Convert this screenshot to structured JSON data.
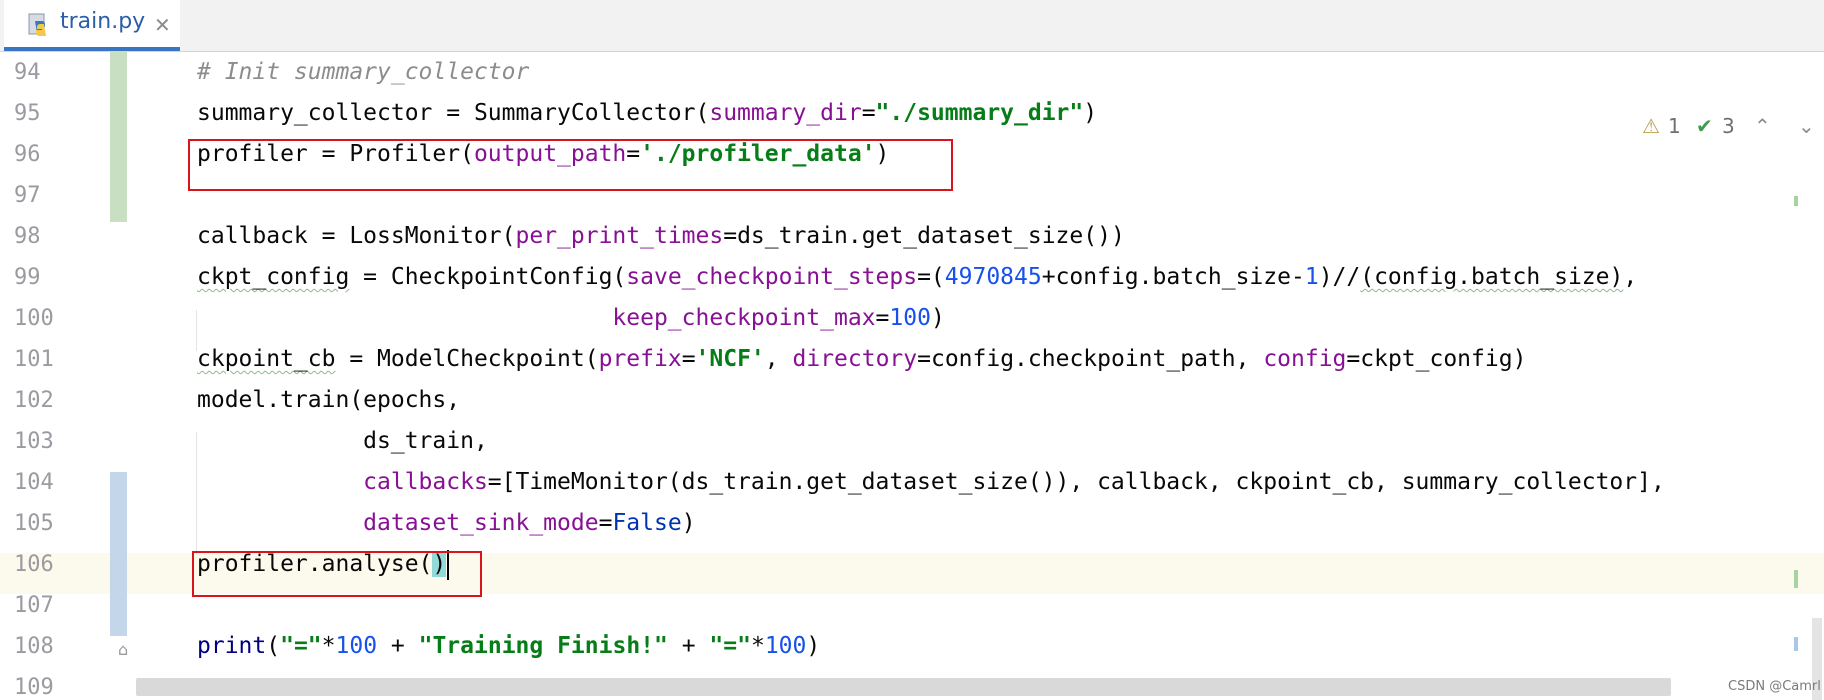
{
  "tab": {
    "filename": "train.py",
    "file_icon": "python-file-icon",
    "close_glyph": "✕"
  },
  "inspections": {
    "warning_count": "1",
    "ok_count": "3"
  },
  "editor": {
    "lines": [
      {
        "number": "94",
        "tokens": [
          {
            "t": "# Init summary_collector",
            "c": "comment"
          }
        ]
      },
      {
        "number": "95",
        "tokens": [
          {
            "t": "summary_collector = SummaryCollector("
          },
          {
            "t": "summary_dir",
            "c": "kw-arg"
          },
          {
            "t": "="
          },
          {
            "t": "\"./summary_dir\"",
            "c": "str"
          },
          {
            "t": ")"
          }
        ]
      },
      {
        "number": "96",
        "tokens": [
          {
            "t": "profiler = Profiler("
          },
          {
            "t": "output_path",
            "c": "kw-arg"
          },
          {
            "t": "="
          },
          {
            "t": "'./profiler_data'",
            "c": "str"
          },
          {
            "t": ")"
          }
        ]
      },
      {
        "number": "97",
        "tokens": []
      },
      {
        "number": "98",
        "tokens": [
          {
            "t": "callback = LossMonitor("
          },
          {
            "t": "per_print_times",
            "c": "kw-arg"
          },
          {
            "t": "=ds_train.get_dataset_size())"
          }
        ]
      },
      {
        "number": "99",
        "tokens": [
          {
            "t": "ckpt_config",
            "c": "wavy"
          },
          {
            "t": " = CheckpointConfig("
          },
          {
            "t": "save_checkpoint_steps",
            "c": "kw-arg"
          },
          {
            "t": "=("
          },
          {
            "t": "4970845",
            "c": "num"
          },
          {
            "t": "+config.batch_size-"
          },
          {
            "t": "1",
            "c": "num"
          },
          {
            "t": ")//"
          },
          {
            "t": "(config.batch_size)",
            "c": "wavy"
          },
          {
            "t": ","
          }
        ]
      },
      {
        "number": "100",
        "tokens": [
          {
            "t": "                              "
          },
          {
            "t": "keep_checkpoint_max",
            "c": "kw-arg"
          },
          {
            "t": "="
          },
          {
            "t": "100",
            "c": "num"
          },
          {
            "t": ")"
          }
        ]
      },
      {
        "number": "101",
        "tokens": [
          {
            "t": "ckpoint_cb",
            "c": "wavy"
          },
          {
            "t": " = ModelCheckpoint("
          },
          {
            "t": "prefix",
            "c": "kw-arg"
          },
          {
            "t": "="
          },
          {
            "t": "'NCF'",
            "c": "str"
          },
          {
            "t": ", "
          },
          {
            "t": "directory",
            "c": "kw-arg"
          },
          {
            "t": "=config.checkpoint_path, "
          },
          {
            "t": "config",
            "c": "kw-arg"
          },
          {
            "t": "=ckpt_config)"
          }
        ]
      },
      {
        "number": "102",
        "tokens": [
          {
            "t": "model.train(epochs,"
          }
        ]
      },
      {
        "number": "103",
        "tokens": [
          {
            "t": "            ds_train,"
          }
        ]
      },
      {
        "number": "104",
        "tokens": [
          {
            "t": "            "
          },
          {
            "t": "callbacks",
            "c": "kw-arg"
          },
          {
            "t": "=[TimeMonitor(ds_train.get_dataset_size()), callback, ckpoint_cb, summary_collector],"
          }
        ]
      },
      {
        "number": "105",
        "tokens": [
          {
            "t": "            "
          },
          {
            "t": "dataset_sink_mode",
            "c": "kw-arg"
          },
          {
            "t": "="
          },
          {
            "t": "False",
            "c": "kw"
          },
          {
            "t": ")"
          }
        ]
      },
      {
        "number": "106",
        "tokens": [
          {
            "t": "profiler.analyse("
          },
          {
            "t": ")",
            "c": "paren-hl"
          }
        ],
        "caret": true
      },
      {
        "number": "107",
        "tokens": []
      },
      {
        "number": "108",
        "tokens": [
          {
            "t": "print",
            "c": "builtin"
          },
          {
            "t": "("
          },
          {
            "t": "\"=\"",
            "c": "str"
          },
          {
            "t": "*"
          },
          {
            "t": "100",
            "c": "num"
          },
          {
            "t": " + "
          },
          {
            "t": "\"Training Finish!\"",
            "c": "str"
          },
          {
            "t": " + "
          },
          {
            "t": "\"=\"",
            "c": "str"
          },
          {
            "t": "*"
          },
          {
            "t": "100",
            "c": "num"
          },
          {
            "t": ")"
          }
        ]
      },
      {
        "number": "109",
        "tokens": []
      }
    ]
  },
  "watermark": "CSDN @Camrl"
}
